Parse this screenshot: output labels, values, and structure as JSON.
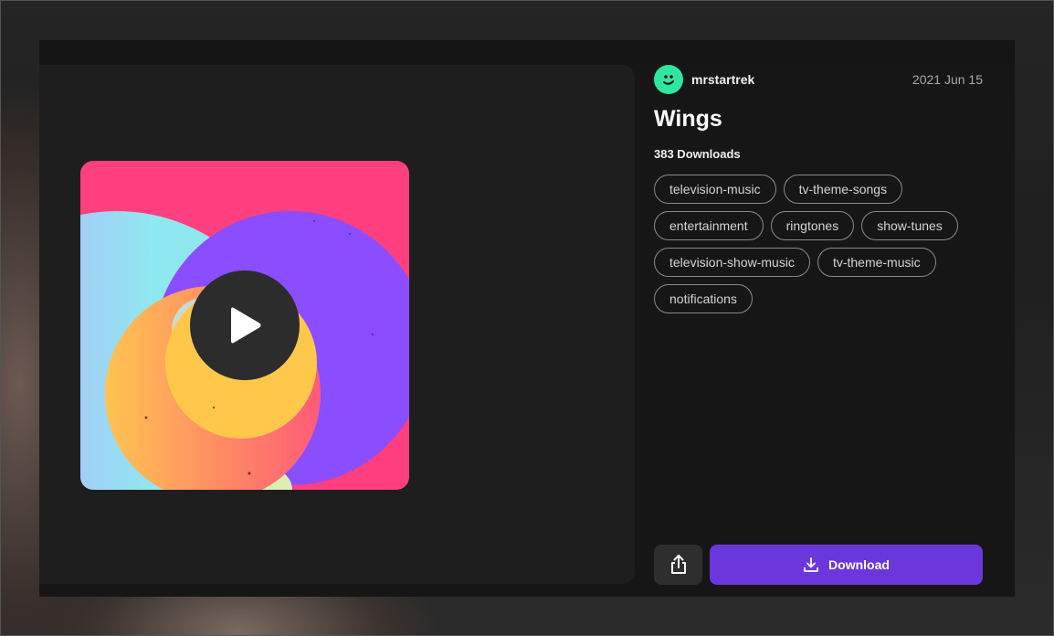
{
  "ringtone": {
    "author": "mrstartrek",
    "date": "2021 Jun 15",
    "title": "Wings",
    "downloads": "383 Downloads",
    "tags": [
      "television-music",
      "tv-theme-songs",
      "entertainment",
      "ringtones",
      "show-tunes",
      "television-show-music",
      "tv-theme-music",
      "notifications"
    ]
  },
  "actions": {
    "download_label": "Download",
    "play_icon": "play-icon",
    "share_icon": "share-icon",
    "download_icon": "download-icon"
  },
  "colors": {
    "accent": "#6c36dd",
    "avatar": "#2fe6a0",
    "artwork_bg": "#ff3f7f",
    "artwork_purple": "#8a4dff",
    "artwork_yellow": "#ffc84a"
  }
}
